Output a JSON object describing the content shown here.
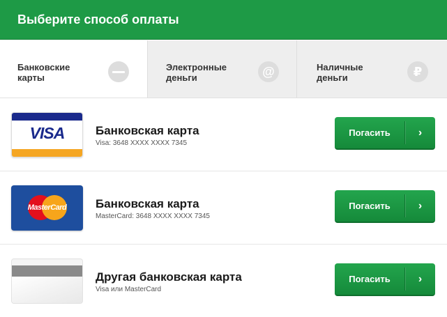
{
  "header": {
    "title": "Выберите способ оплаты"
  },
  "tabs": [
    {
      "label": "Банковские\nкарты",
      "icon": "card-icon",
      "active": true
    },
    {
      "label": "Электронные\nденьги",
      "icon": "at-icon",
      "icon_glyph": "@",
      "active": false
    },
    {
      "label": "Наличные\nденьги",
      "icon": "ruble-icon",
      "icon_glyph": "₽",
      "active": false
    }
  ],
  "rows": [
    {
      "title": "Банковская карта",
      "subtitle": "Visa: 3648 XXXX XXXX 7345",
      "card": "visa-card",
      "card_text": "VISA",
      "button": "Погасить",
      "arrow": "›"
    },
    {
      "title": "Банковская карта",
      "subtitle": "MasterCard: 3648 XXXX XXXX 7345",
      "card": "mastercard-card",
      "card_text": "MasterCard",
      "button": "Погасить",
      "arrow": "›"
    },
    {
      "title": "Другая банковская карта",
      "subtitle": "Visa или MasterCard",
      "card": "generic-card",
      "button": "Погасить",
      "arrow": "›"
    }
  ],
  "colors": {
    "accent": "#1e9a46",
    "visa_blue": "#1a2a8c",
    "visa_gold": "#f5a623",
    "mc_red": "#e3101d",
    "mc_yellow": "#f7a51b"
  }
}
